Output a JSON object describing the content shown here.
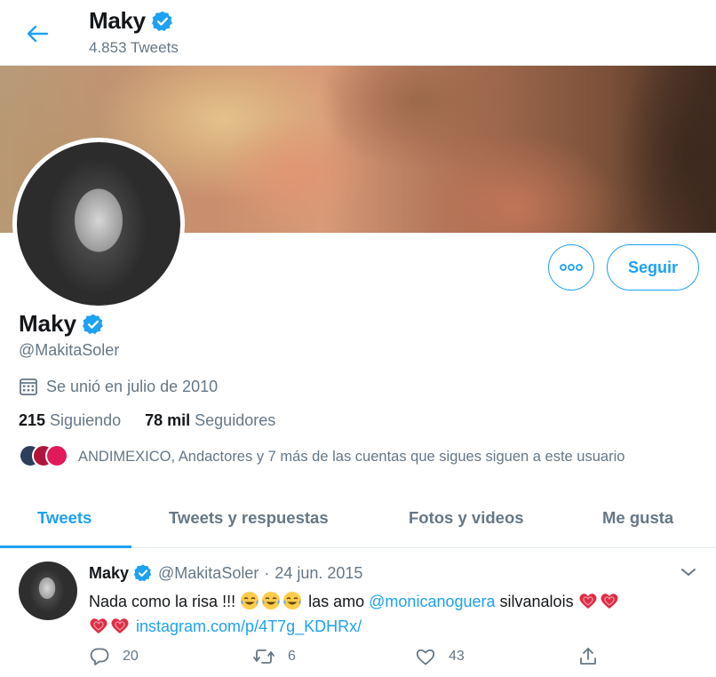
{
  "colors": {
    "accent": "#1da1f2",
    "text_primary": "#14171a",
    "text_secondary": "#657786",
    "border": "#e6ecf0",
    "heart": "#e0245e"
  },
  "header": {
    "back_icon": "arrow-left-icon",
    "name": "Maky",
    "tweet_count": "4.853 Tweets"
  },
  "profile": {
    "name": "Maky",
    "handle": "@MakitaSoler",
    "joined": "Se unió en julio de 2010",
    "joined_icon": "calendar-icon",
    "verified_icon": "verified-badge-icon",
    "more_icon": "more-options-icon",
    "follow_label": "Seguir",
    "following_count": "215",
    "following_label": "Siguiendo",
    "followers_count": "78 mil",
    "followers_label": "Seguidores",
    "known_followers_text": "ANDIMEXICO, Andactores y 7 más de las cuentas que sigues siguen a este usuario"
  },
  "tabs": [
    {
      "label": "Tweets",
      "active": true
    },
    {
      "label": "Tweets y respuestas",
      "active": false
    },
    {
      "label": "Fotos y videos",
      "active": false
    },
    {
      "label": "Me gusta",
      "active": false
    }
  ],
  "tweet": {
    "name": "Maky",
    "handle": "@MakitaSoler",
    "separator": "·",
    "date": "24 jun. 2015",
    "text_part1": "Nada como la risa !!!",
    "text_part2": "las amo",
    "mention": "@monicanoguera",
    "text_part3": "silvanalois",
    "link": "instagram.com/p/4T7g_KDHRx/",
    "emoji_icon": "laughing-tears-emoji",
    "heart_emoji_icon": "red-heart-emoji",
    "reply_count": "20",
    "retweet_count": "6",
    "like_count": "43",
    "reply_icon": "reply-icon",
    "retweet_icon": "retweet-icon",
    "like_icon": "like-icon",
    "share_icon": "share-icon"
  }
}
